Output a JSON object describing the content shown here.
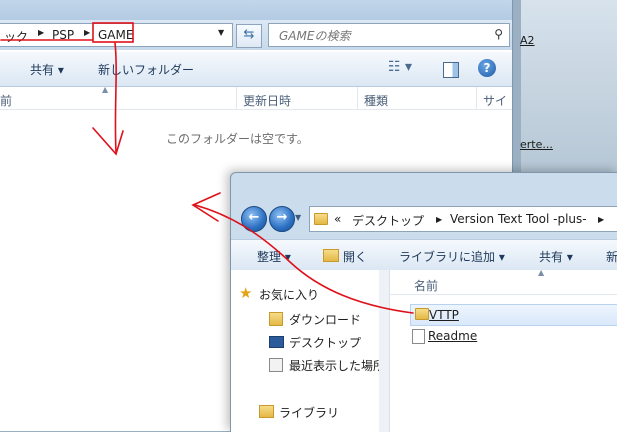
{
  "desktop": {
    "items": [
      "A2",
      "erte..."
    ]
  },
  "back_window": {
    "breadcrumb": [
      "ック",
      "PSP",
      "GAME"
    ],
    "search_placeholder": "GAMEの検索",
    "toolbar": {
      "share": "共有 ▾",
      "new_folder": "新しいフォルダー"
    },
    "columns": [
      "前",
      "更新日時",
      "種類",
      "サイ"
    ],
    "empty_message": "このフォルダーは空です。"
  },
  "front_window": {
    "breadcrumb": [
      "«",
      "デスクトップ",
      "Version Text Tool -plus-"
    ],
    "toolbar": {
      "organize": "整理 ▾",
      "open": "開く",
      "add_library": "ライブラリに追加 ▾",
      "share": "共有 ▾",
      "new": "新"
    },
    "nav": {
      "favorites": "お気に入り",
      "downloads": "ダウンロード",
      "desktop": "デスクトップ",
      "recent": "最近表示した場所",
      "libraries": "ライブラリ"
    },
    "column_name": "名前",
    "files": [
      {
        "name": "VTTP",
        "type": "folder",
        "selected": true
      },
      {
        "name": "Readme",
        "type": "document",
        "selected": false
      }
    ]
  },
  "annotation_color": "#e0101a"
}
